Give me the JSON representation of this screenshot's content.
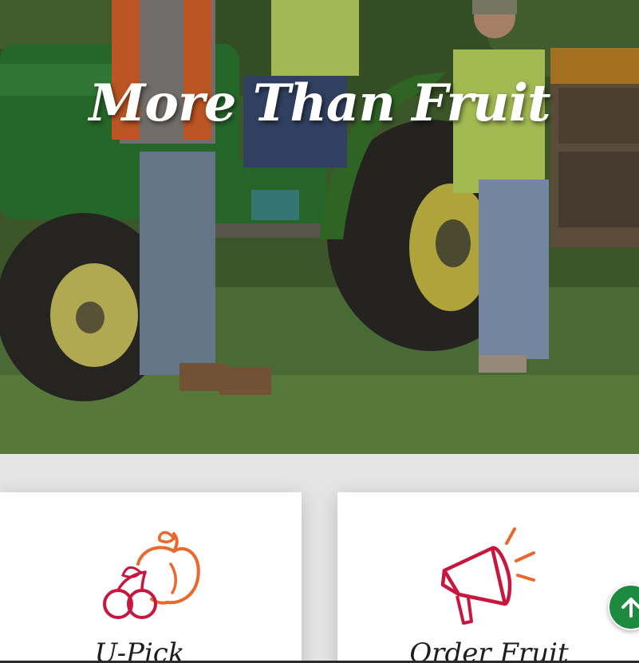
{
  "hero": {
    "title": "More Than Fruit"
  },
  "cards": [
    {
      "title": "U-Pick",
      "icon": "fruit-icon"
    },
    {
      "title": "Order Fruit",
      "icon": "megaphone-icon"
    }
  ],
  "scroll_top": {
    "icon": "arrow-up-icon"
  },
  "colors": {
    "accent_green": "#1d8a3f",
    "icon_orange": "#e9692c",
    "icon_red": "#c8173f"
  }
}
